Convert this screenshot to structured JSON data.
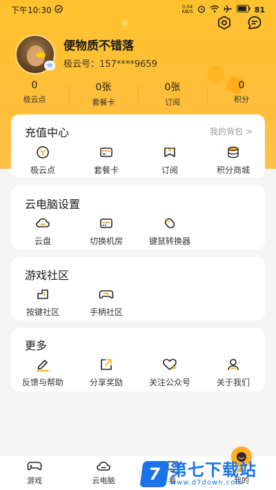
{
  "status_bar": {
    "time": "下午10:30",
    "net_speed_value": "0.04",
    "net_speed_unit": "KB/S",
    "battery": "81"
  },
  "profile": {
    "username": "便物质不错落",
    "user_id": "极云号：157****9659"
  },
  "stats": [
    {
      "value": "0",
      "label": "极云点"
    },
    {
      "value": "0张",
      "label": "套餐卡"
    },
    {
      "value": "0张",
      "label": "订阅"
    },
    {
      "value": "0",
      "label": "积分"
    }
  ],
  "recharge": {
    "title": "充值中心",
    "link": "我的背包 >",
    "items": [
      {
        "label": "极云点",
        "icon": "coin-icon"
      },
      {
        "label": "套餐卡",
        "icon": "card-icon"
      },
      {
        "label": "订阅",
        "icon": "bookmark-icon"
      },
      {
        "label": "积分商城",
        "icon": "database-icon"
      }
    ]
  },
  "settings": {
    "title": "云电脑设置",
    "items": [
      {
        "label": "云盘",
        "icon": "cloud-icon"
      },
      {
        "label": "切换机房",
        "icon": "server-icon"
      },
      {
        "label": "键鼠转换器",
        "icon": "mouse-icon"
      }
    ]
  },
  "community": {
    "title": "游戏社区",
    "items": [
      {
        "label": "按键社区",
        "icon": "key-icon"
      },
      {
        "label": "手柄社区",
        "icon": "gamepad-icon"
      }
    ]
  },
  "more": {
    "title": "更多",
    "items": [
      {
        "label": "反馈与帮助",
        "icon": "edit-icon"
      },
      {
        "label": "分享奖励",
        "icon": "share-icon"
      },
      {
        "label": "关注公众号",
        "icon": "heart-icon"
      },
      {
        "label": "关于我们",
        "icon": "person-icon"
      }
    ]
  },
  "bottom_nav": [
    {
      "label": "游戏",
      "icon": "gamepad-nav-icon"
    },
    {
      "label": "云电脑",
      "icon": "cloud-nav-icon"
    },
    {
      "label": "看",
      "icon": "screen-nav-icon"
    },
    {
      "label": "我的",
      "icon": "user-nav-icon"
    }
  ],
  "watermark": {
    "logo": "7",
    "title": "第七下载站",
    "url": "www.d7down.com"
  },
  "colors": {
    "brand": "#ffc22e",
    "accent": "#ffb020",
    "watermark": "#1a73e8"
  }
}
